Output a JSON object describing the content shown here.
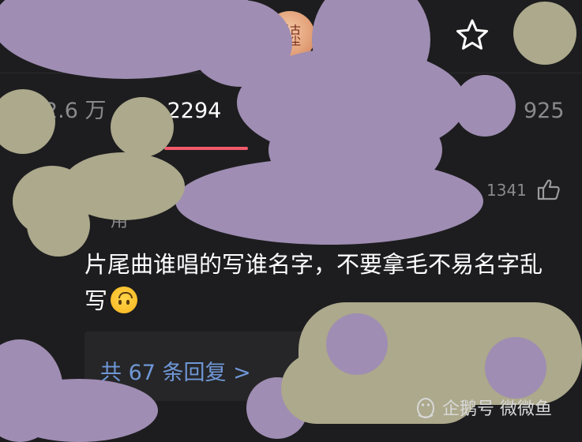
{
  "header": {
    "avatar_text": "千古玦尘",
    "favorite_icon": "star-outline-icon"
  },
  "tabs": [
    {
      "label": "2.6 万"
    },
    {
      "label": "论 2294",
      "active": true
    },
    {
      "label": "925"
    }
  ],
  "comment": {
    "like_count": "1341",
    "like_icon": "thumbs-up-icon",
    "author_partial": "用",
    "text": "片尾曲谁唱的写谁名字，不要拿毛不易名字乱写",
    "emoji": "upside-down-face-emoji"
  },
  "replies": {
    "label": "共 67 条回复 >"
  },
  "watermark": {
    "text": "企鹅号 微微鱼",
    "icon": "penguin-icon"
  },
  "colors": {
    "background": "#1d1d1f",
    "tab_indicator": "#f25b6b",
    "reply_link": "#6f97d6",
    "redaction_lavender": "#9f8db3",
    "redaction_olive": "#aca98c"
  }
}
